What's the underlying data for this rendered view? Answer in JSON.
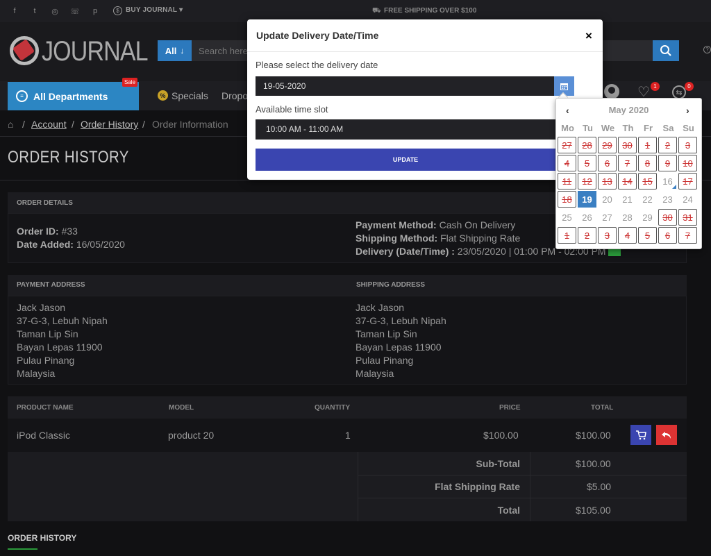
{
  "topbar": {
    "social": [
      {
        "icon": "facebook-icon",
        "glyph": "f"
      },
      {
        "icon": "twitter-icon",
        "glyph": "t"
      },
      {
        "icon": "instagram-icon",
        "glyph": "◎"
      },
      {
        "icon": "whatsapp-icon",
        "glyph": "☏"
      },
      {
        "icon": "pinterest-icon",
        "glyph": "p"
      }
    ],
    "buy_journal": "BUY JOURNAL",
    "free_shipping": "FREE SHIPPING OVER $100"
  },
  "header": {
    "logo_text": "JOURNAL",
    "search_category": "All",
    "search_placeholder": "Search here...",
    "accent": "#2c79bd"
  },
  "menu": {
    "all_departments": "All Departments",
    "sale_badge": "Sale",
    "specials": "Specials",
    "dropdown_partial": "Dropo",
    "wishlist_count": "1",
    "compare_count": "0"
  },
  "breadcrumb": {
    "items": [
      "Account",
      "Order History"
    ],
    "current": "Order Information"
  },
  "page": {
    "title": "ORDER HISTORY",
    "bottom_title": "ORDER HISTORY"
  },
  "order_details": {
    "heading": "ORDER DETAILS",
    "order_id_label": "Order ID:",
    "order_id": "#33",
    "date_added_label": "Date Added:",
    "date_added": "16/05/2020",
    "payment_method_label": "Payment Method:",
    "payment_method": "Cash On Delivery",
    "shipping_method_label": "Shipping Method:",
    "shipping_method": "Flat Shipping Rate",
    "delivery_label": "Delivery (Date/Time) :",
    "delivery_value": "23/05/2020 | 01:00 PM - 02:00 PM"
  },
  "addresses": {
    "payment_heading": "PAYMENT ADDRESS",
    "shipping_heading": "SHIPPING ADDRESS",
    "payment_lines": [
      "Jack Jason",
      "37-G-3, Lebuh Nipah",
      "Taman Lip Sin",
      "Bayan Lepas 11900",
      "Pulau Pinang",
      "Malaysia"
    ],
    "shipping_lines": [
      "Jack Jason",
      "37-G-3, Lebuh Nipah",
      "Taman Lip Sin",
      "Bayan Lepas 11900",
      "Pulau Pinang",
      "Malaysia"
    ]
  },
  "products": {
    "columns": [
      "PRODUCT NAME",
      "MODEL",
      "QUANTITY",
      "PRICE",
      "TOTAL"
    ],
    "rows": [
      {
        "name": "iPod Classic",
        "model": "product 20",
        "quantity": "1",
        "price": "$100.00",
        "total": "$100.00"
      }
    ],
    "totals": [
      {
        "label": "Sub-Total",
        "value": "$100.00"
      },
      {
        "label": "Flat Shipping Rate",
        "value": "$5.00"
      },
      {
        "label": "Total",
        "value": "$105.00"
      }
    ]
  },
  "modal": {
    "title": "Update Delivery Date/Time",
    "close": "×",
    "date_label": "Please select the delivery date",
    "date_value": "19-05-2020",
    "slot_label": "Available time slot",
    "slot_value": "10:00 AM - 11:00 AM",
    "update_button": "UPDATE"
  },
  "datepicker": {
    "month": "May 2020",
    "prev": "‹",
    "next": "›",
    "weekdays": [
      "Mo",
      "Tu",
      "We",
      "Th",
      "Fr",
      "Sa",
      "Su"
    ],
    "weeks": [
      [
        {
          "d": "27",
          "s": "dis"
        },
        {
          "d": "28",
          "s": "dis"
        },
        {
          "d": "29",
          "s": "dis"
        },
        {
          "d": "30",
          "s": "dis"
        },
        {
          "d": "1",
          "s": "dis"
        },
        {
          "d": "2",
          "s": "dis"
        },
        {
          "d": "3",
          "s": "dis"
        }
      ],
      [
        {
          "d": "4",
          "s": "dis"
        },
        {
          "d": "5",
          "s": "dis"
        },
        {
          "d": "6",
          "s": "dis"
        },
        {
          "d": "7",
          "s": "dis"
        },
        {
          "d": "8",
          "s": "dis"
        },
        {
          "d": "9",
          "s": "dis"
        },
        {
          "d": "10",
          "s": "dis"
        }
      ],
      [
        {
          "d": "11",
          "s": "dis"
        },
        {
          "d": "12",
          "s": "dis"
        },
        {
          "d": "13",
          "s": "dis"
        },
        {
          "d": "14",
          "s": "dis"
        },
        {
          "d": "15",
          "s": "dis"
        },
        {
          "d": "16",
          "s": "today"
        },
        {
          "d": "17",
          "s": "dis"
        }
      ],
      [
        {
          "d": "18",
          "s": "dis"
        },
        {
          "d": "19",
          "s": "sel"
        },
        {
          "d": "20",
          "s": ""
        },
        {
          "d": "21",
          "s": ""
        },
        {
          "d": "22",
          "s": ""
        },
        {
          "d": "23",
          "s": ""
        },
        {
          "d": "24",
          "s": ""
        }
      ],
      [
        {
          "d": "25",
          "s": ""
        },
        {
          "d": "26",
          "s": ""
        },
        {
          "d": "27",
          "s": ""
        },
        {
          "d": "28",
          "s": ""
        },
        {
          "d": "29",
          "s": ""
        },
        {
          "d": "30",
          "s": "dis"
        },
        {
          "d": "31",
          "s": "dis"
        }
      ],
      [
        {
          "d": "1",
          "s": "dis"
        },
        {
          "d": "2",
          "s": "dis"
        },
        {
          "d": "3",
          "s": "dis"
        },
        {
          "d": "4",
          "s": "dis"
        },
        {
          "d": "5",
          "s": "dis"
        },
        {
          "d": "6",
          "s": "dis"
        },
        {
          "d": "7",
          "s": "dis"
        }
      ]
    ]
  }
}
